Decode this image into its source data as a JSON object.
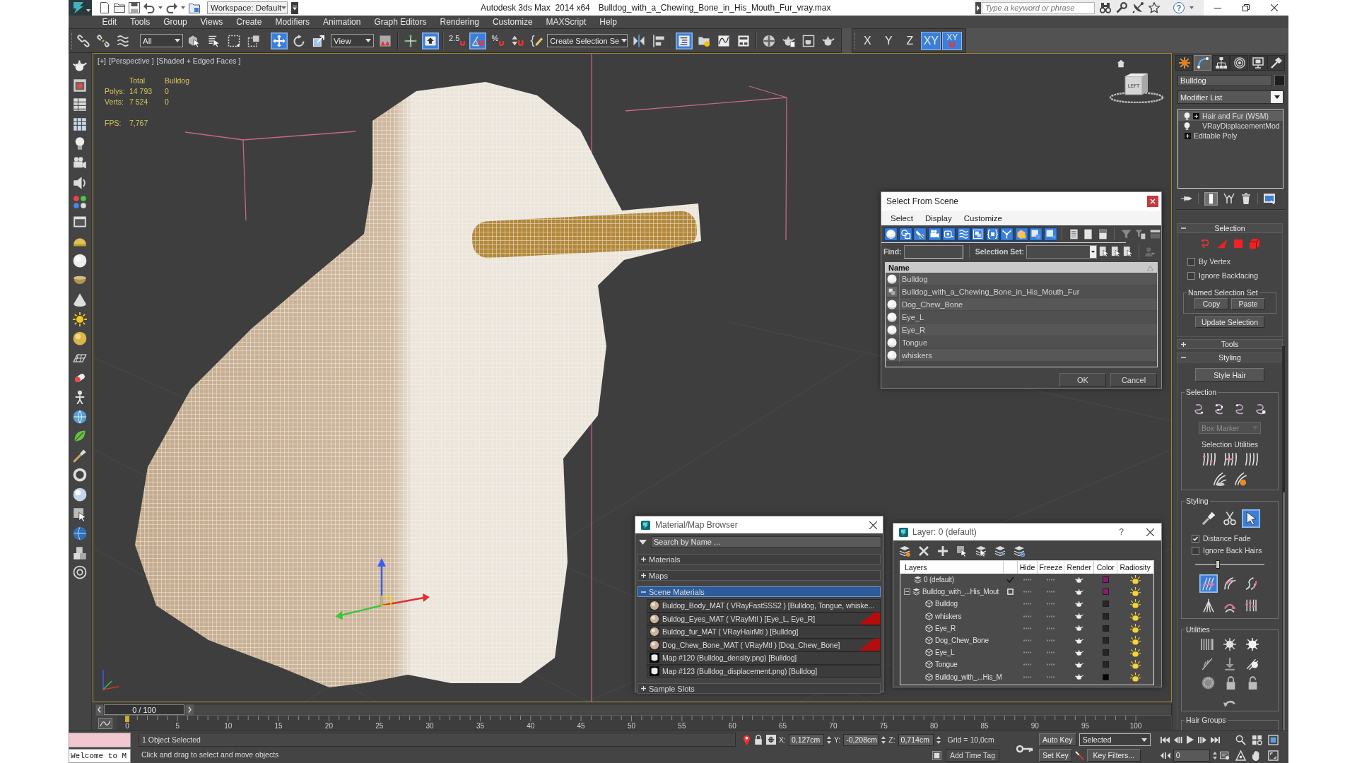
{
  "title_bar": {
    "workspace": "Workspace: Default",
    "app_title": "Autodesk 3ds Max  2014 x64",
    "file_name": "Bulldog_with_a_Chewing_Bone_in_His_Mouth_Fur_vray.max",
    "search": {
      "placeholder": "Type a keyword or phrase"
    },
    "help": "?"
  },
  "menu_bar": [
    "Edit",
    "Tools",
    "Group",
    "Views",
    "Create",
    "Modifiers",
    "Animation",
    "Graph Editors",
    "Rendering",
    "Customize",
    "MAXScript",
    "Help"
  ],
  "main_toolbar": [
    {
      "kind": "link",
      "on": false
    },
    {
      "kind": "unlink",
      "on": false
    },
    {
      "kind": "bind",
      "on": false
    },
    {
      "kind": "dropdown",
      "label": "All"
    },
    {
      "kind": "select",
      "on": false
    },
    {
      "kind": "select_by_name",
      "on": false
    },
    {
      "kind": "region",
      "on": false
    },
    {
      "kind": "crossing",
      "on": false
    },
    {
      "kind": "separator"
    },
    {
      "kind": "move",
      "on": true
    },
    {
      "kind": "rotate",
      "on": false
    },
    {
      "kind": "scale",
      "on": false
    },
    {
      "kind": "dropdown",
      "label": "View"
    },
    {
      "kind": "pivot",
      "on": false
    },
    {
      "kind": "separator"
    },
    {
      "kind": "manipulate",
      "on": false
    },
    {
      "kind": "shortcut_override",
      "on": true
    },
    {
      "kind": "separator"
    },
    {
      "kind": "snap",
      "label": "2.5",
      "on": false
    },
    {
      "kind": "angle_snap",
      "on": true
    },
    {
      "kind": "snap",
      "label": "%",
      "on": false
    },
    {
      "kind": "spinner_snap",
      "on": false
    },
    {
      "kind": "named_sets",
      "on": false
    },
    {
      "kind": "dropdown",
      "label": "Create Selection Se"
    },
    {
      "kind": "mirror",
      "on": false
    },
    {
      "kind": "align",
      "on": false
    },
    {
      "kind": "separator"
    },
    {
      "kind": "scene_explorer",
      "on": true
    },
    {
      "kind": "layers",
      "on": false
    },
    {
      "kind": "curve_editor",
      "on": false
    },
    {
      "kind": "schematic",
      "on": false
    },
    {
      "kind": "separator"
    },
    {
      "kind": "material_editor",
      "on": false
    },
    {
      "kind": "render_setup",
      "on": false
    },
    {
      "kind": "frame_window",
      "on": false
    },
    {
      "kind": "render",
      "on": false
    },
    {
      "kind": "break"
    },
    {
      "kind": "axis",
      "label": "X",
      "on": false
    },
    {
      "kind": "axis",
      "label": "Y",
      "on": false
    },
    {
      "kind": "axis",
      "label": "Z",
      "on": false
    },
    {
      "kind": "axis",
      "label": "XY",
      "on": true
    },
    {
      "kind": "axis_snap",
      "label": "XY",
      "on": true
    }
  ],
  "viewport": {
    "labels": [
      "[+]",
      "[Perspective ]",
      "[Shaded + Edged Faces ]"
    ],
    "stats": {
      "columns": [
        "Total",
        "Bulldog"
      ],
      "rows": [
        {
          "label": "Polys:",
          "values": [
            "14 793",
            "0"
          ]
        },
        {
          "label": "Verts:",
          "values": [
            "7 524",
            "0"
          ]
        }
      ],
      "fps": {
        "label": "FPS:",
        "value": "7,767"
      }
    },
    "view_cube": {
      "face": "LEFT"
    }
  },
  "select_from_scene": {
    "title": "Select From Scene",
    "menu": [
      "Select",
      "Display",
      "Customize"
    ],
    "filters": [
      {
        "kind": "geometry",
        "on": true
      },
      {
        "kind": "shape",
        "on": true
      },
      {
        "kind": "light",
        "on": true
      },
      {
        "kind": "camera",
        "on": true
      },
      {
        "kind": "helper",
        "on": true
      },
      {
        "kind": "space_warp",
        "on": true
      },
      {
        "kind": "group",
        "on": true
      },
      {
        "kind": "xref",
        "on": true
      },
      {
        "kind": "bone",
        "on": true
      },
      {
        "kind": "container",
        "on": true
      },
      {
        "kind": "frozen",
        "on": true
      },
      {
        "kind": "hidden",
        "on": true
      },
      {
        "kind": "select_all",
        "on": false
      },
      {
        "kind": "select_none",
        "on": false
      },
      {
        "kind": "select_invert",
        "on": false
      },
      {
        "kind": "filter",
        "on": false
      },
      {
        "kind": "filter_selected",
        "on": false
      },
      {
        "kind": "columns",
        "on": false
      }
    ],
    "find": {
      "label": "Find:"
    },
    "selection_set": {
      "label": "Selection Set:"
    },
    "column": "Name",
    "rows": [
      {
        "name": "Bulldog",
        "kind": "geometry",
        "selected": false
      },
      {
        "name": "Bulldog_with_a_Chewing_Bone_in_His_Mouth_Fur",
        "kind": "group",
        "selected": false
      },
      {
        "name": "Dog_Chew_Bone",
        "kind": "geometry",
        "selected": false
      },
      {
        "name": "Eye_L",
        "kind": "geometry",
        "selected": false
      },
      {
        "name": "Eye_R",
        "kind": "geometry",
        "selected": false
      },
      {
        "name": "Tongue",
        "kind": "geometry",
        "selected": false
      },
      {
        "name": "whiskers",
        "kind": "geometry",
        "selected": false
      }
    ],
    "buttons": [
      "OK",
      "Cancel"
    ]
  },
  "material_browser": {
    "title": "Material/Map Browser",
    "search": {
      "placeholder": "Search by Name ..."
    },
    "groups": [
      {
        "label": "Materials",
        "expanded": false,
        "selected": false
      },
      {
        "label": "Maps",
        "expanded": false,
        "selected": false
      },
      {
        "label": "Scene Materials",
        "expanded": true,
        "selected": true,
        "items": [
          {
            "label": "Buldog_Body_MAT ( VRayFastSSS2 ) [Bulldog, Tongue, whiske...",
            "kind": "material",
            "in_viewport": false
          },
          {
            "label": "Buldog_Eyes_MAT ( VRayMtl ) [Eye_L, Eye_R]",
            "kind": "material",
            "in_viewport": true
          },
          {
            "label": "Buldog_fur_MAT ( VRayHairMtl ) [Bulldog]",
            "kind": "material",
            "in_viewport": false
          },
          {
            "label": "Dog_Chew_Bone_MAT ( VRayMtl ) [Dog_Chew_Bone]",
            "kind": "material",
            "in_viewport": true
          },
          {
            "label": "Map #120 (Bulldog_density.png) [Bulldog]",
            "kind": "map",
            "in_viewport": false
          },
          {
            "label": "Map #123 (Bulldog_displacement.png) [Bulldog]",
            "kind": "map",
            "in_viewport": false
          }
        ]
      },
      {
        "label": "Sample Slots",
        "expanded": false,
        "selected": false
      }
    ]
  },
  "layer_manager": {
    "title": "Layer: 0 (default)",
    "help": "?",
    "columns": [
      "Layers",
      "Hide",
      "Freeze",
      "Render",
      "Color",
      "Radiosity"
    ],
    "layers": [
      {
        "name": "0 (default)",
        "kind": "layer",
        "current": true,
        "hidden": false,
        "frozen": false,
        "renderable": true,
        "radiosity": true,
        "color": "#8c1a6e",
        "selected": false
      },
      {
        "name": "Bulldog_with_...His_Mout",
        "kind": "layer",
        "current": false,
        "expanded": true,
        "hidden": false,
        "frozen": false,
        "renderable": true,
        "radiosity": true,
        "color": "#8c1a6e",
        "selected": false,
        "children": [
          {
            "name": "Bulldog",
            "kind": "object",
            "hidden": false,
            "frozen": false,
            "renderable": true,
            "radiosity": true,
            "color": "#262626",
            "selected": false
          },
          {
            "name": "whiskers",
            "kind": "object",
            "hidden": false,
            "frozen": false,
            "renderable": true,
            "radiosity": true,
            "color": "#262626",
            "selected": false
          },
          {
            "name": "Eye_R",
            "kind": "object",
            "hidden": false,
            "frozen": false,
            "renderable": true,
            "radiosity": true,
            "color": "#262626",
            "selected": false
          },
          {
            "name": "Dog_Chew_Bone",
            "kind": "object",
            "hidden": false,
            "frozen": false,
            "renderable": true,
            "radiosity": true,
            "color": "#262626",
            "selected": false
          },
          {
            "name": "Eye_L",
            "kind": "object",
            "hidden": false,
            "frozen": false,
            "renderable": true,
            "radiosity": true,
            "color": "#262626",
            "selected": false
          },
          {
            "name": "Tongue",
            "kind": "object",
            "hidden": false,
            "frozen": false,
            "renderable": true,
            "radiosity": true,
            "color": "#262626",
            "selected": false
          },
          {
            "name": "Bulldog_with_...His_M",
            "kind": "object",
            "hidden": false,
            "frozen": false,
            "renderable": true,
            "radiosity": true,
            "color": "#050505",
            "selected": false
          }
        ]
      }
    ]
  },
  "command_panel": {
    "tabs": [
      {
        "kind": "create",
        "selected": false
      },
      {
        "kind": "modify",
        "selected": true
      },
      {
        "kind": "hierarchy",
        "selected": false
      },
      {
        "kind": "motion",
        "selected": false
      },
      {
        "kind": "display",
        "selected": false
      },
      {
        "kind": "utilities",
        "selected": false
      }
    ],
    "object_name": "Bulldog",
    "modifier_list": "Modifier List",
    "stack": [
      {
        "label": "Hair and Fur (WSM)",
        "kind": "modifier",
        "enabled": true,
        "expanded": false,
        "selected": true
      },
      {
        "label": "VRayDisplacementMod",
        "kind": "modifier",
        "enabled": true,
        "selected": false
      },
      {
        "label": "Editable Poly",
        "kind": "base",
        "expanded": false,
        "selected": false
      }
    ],
    "stack_tools": [
      {
        "kind": "pin",
        "on": false
      },
      {
        "kind": "show_end_result",
        "on": true
      },
      {
        "kind": "make_unique",
        "on": false
      },
      {
        "kind": "remove",
        "on": false
      },
      {
        "kind": "configure",
        "on": false
      }
    ],
    "rollouts": [
      {
        "title": "Selection",
        "kind": "selection",
        "expanded": true,
        "levels": [
          {
            "kind": "guide",
            "selected": false
          },
          {
            "kind": "face",
            "selected": false
          },
          {
            "kind": "polygon",
            "selected": false
          },
          {
            "kind": "element",
            "selected": false
          }
        ],
        "checkboxes": [
          {
            "label": "By Vertex",
            "checked": false
          },
          {
            "label": "Ignore Backfacing",
            "checked": false
          }
        ],
        "named_set": {
          "title": "Named Selection Set",
          "buttons": [
            "Copy",
            "Paste"
          ]
        },
        "button": "Update Selection"
      },
      {
        "title": "Tools",
        "kind": "tools",
        "expanded": false
      },
      {
        "title": "Styling",
        "kind": "styling",
        "expanded": true,
        "button": "Style Hair",
        "groups": [
          {
            "title": "Selection",
            "kind": "selection",
            "tools": [
              {
                "kind": "ends",
                "selected": false
              },
              {
                "kind": "whole",
                "selected": false
              },
              {
                "kind": "roots",
                "selected": false
              },
              {
                "kind": "vertices",
                "selected": false
              }
            ],
            "dropdown": {
              "label": "Box Marker",
              "disabled": true
            },
            "subtitle": "Selection Utilities"
          },
          {
            "title": "Styling",
            "kind": "styling",
            "tools": [
              {
                "kind": "brush",
                "selected": false
              },
              {
                "kind": "cut",
                "selected": false
              },
              {
                "kind": "select",
                "selected": true
              }
            ],
            "checkboxes": [
              {
                "label": "Distance Fade",
                "checked": true
              },
              {
                "label": "Ignore Back Hairs",
                "checked": false
              }
            ],
            "slider": {
              "level": 0.31
            },
            "brushes": [
              {
                "kind": "translate",
                "selected": true
              },
              {
                "kind": "stand",
                "selected": false
              },
              {
                "kind": "puff",
                "selected": false
              },
              {
                "kind": "clump",
                "selected": false
              },
              {
                "kind": "rotate",
                "selected": false
              },
              {
                "kind": "scale",
                "selected": false
              }
            ]
          },
          {
            "title": "Utilities",
            "kind": "utilities"
          },
          {
            "title": "Hair Groups",
            "kind": "hair_groups"
          }
        ]
      }
    ]
  },
  "time_slider": {
    "label": "0 / 100",
    "level": 0
  },
  "track_bar": {
    "frames": [
      "0",
      "5",
      "10",
      "15",
      "20",
      "25",
      "30",
      "35",
      "40",
      "45",
      "50",
      "55",
      "60",
      "65",
      "70",
      "75",
      "80",
      "85",
      "90",
      "95",
      "100"
    ]
  },
  "status_bar": {
    "listener": {
      "output": "Welcome to M"
    },
    "selection": "1 Object Selected",
    "prompt": "Click and drag to select and move objects",
    "coords": [
      {
        "axis": "X:",
        "value": "0,127cm"
      },
      {
        "axis": "Y:",
        "value": "-0,208cm"
      },
      {
        "axis": "Z:",
        "value": "0,714cm"
      }
    ],
    "grid": "Grid = 10,0cm",
    "time_tag": "Add Time Tag",
    "auto_key": {
      "label": "Auto Key",
      "on": false
    },
    "key_mode": "Selected",
    "set_key": "Set Key",
    "key_filters": "Key Filters...",
    "frame": "0"
  }
}
